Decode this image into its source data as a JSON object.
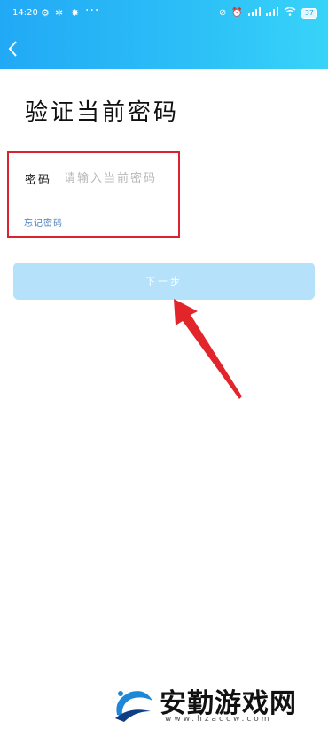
{
  "statusbar": {
    "time": "14:20",
    "dots": "···",
    "battery": "37"
  },
  "header": {
    "back_icon": "chevron-left-icon"
  },
  "title": "验证当前密码",
  "password": {
    "label": "密码",
    "placeholder": "请输入当前密码",
    "value": ""
  },
  "forgot_label": "忘记密码",
  "next_label": "下一步",
  "watermark": {
    "text": "安勤游戏网",
    "url": "www.hzaccw.com"
  },
  "colors": {
    "header": "#2ab4f6",
    "button": "#b5e1fb",
    "link": "#4a7fc2",
    "annotation": "#d9232d"
  }
}
